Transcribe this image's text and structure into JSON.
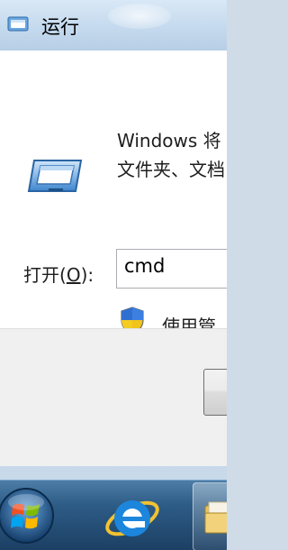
{
  "window": {
    "title": "运行",
    "icon": "run-dialog-icon"
  },
  "dialog": {
    "description_line1": "Windows 将",
    "description_line2": "文件夹、文档",
    "open_label_prefix": "打开(",
    "open_label_hotkey": "O",
    "open_label_suffix": "):",
    "command_value": "cmd",
    "admin_note": "使用管",
    "icons": [
      "run-program-icon",
      "uac-shield-icon"
    ]
  },
  "taskbar": {
    "items": [
      "start-button",
      "internet-explorer",
      "windows-explorer"
    ]
  },
  "colors": {
    "titlebar": "#c6dbef",
    "client": "#ffffff",
    "footer": "#f0f0f0",
    "taskbar": "#2d5c86"
  }
}
